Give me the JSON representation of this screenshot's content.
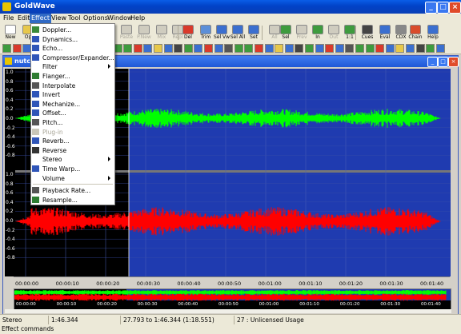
{
  "app": {
    "title": "GoldWave"
  },
  "window_controls": {
    "minimize": "_",
    "maximize": "□",
    "close": "×"
  },
  "menubar": [
    "File",
    "Edit",
    "Effect",
    "View",
    "Tool",
    "Options",
    "Window",
    "Help"
  ],
  "toolbar": {
    "buttons": [
      {
        "label": "New",
        "icon": "new-file-icon",
        "color": "#ffffff",
        "enabled": true
      },
      {
        "label": "Op",
        "icon": "open-icon",
        "color": "#e7c84a",
        "enabled": true
      },
      {
        "label": "Paste",
        "icon": "paste-icon",
        "color": "#cfccbf",
        "enabled": false
      },
      {
        "label": "P.New",
        "icon": "paste-new-icon",
        "color": "#cfccbf",
        "enabled": false
      },
      {
        "label": "Mix",
        "icon": "mix-icon",
        "color": "#cfccbf",
        "enabled": false
      },
      {
        "label": "Repl",
        "icon": "replace-icon",
        "color": "#cfccbf",
        "enabled": false
      },
      {
        "label": "Del",
        "icon": "delete-icon",
        "color": "#d93a2b",
        "enabled": true
      },
      {
        "label": "Trim",
        "icon": "trim-icon",
        "color": "#5b8fd8",
        "enabled": true
      },
      {
        "label": "Sel Vw",
        "icon": "select-view-icon",
        "color": "#3b6fcf",
        "enabled": true
      },
      {
        "label": "Sel All",
        "icon": "select-all-icon",
        "color": "#3b6fcf",
        "enabled": true
      },
      {
        "label": "Set",
        "icon": "set-icon",
        "color": "#3b6fcf",
        "enabled": true
      },
      {
        "label": "All",
        "icon": "zoom-all-icon",
        "color": "#cfccbf",
        "enabled": false
      },
      {
        "label": "Sel",
        "icon": "zoom-sel-icon",
        "color": "#3e9b3e",
        "enabled": true
      },
      {
        "label": "Prev",
        "icon": "zoom-prev-icon",
        "color": "#cfccbf",
        "enabled": false
      },
      {
        "label": "In",
        "icon": "zoom-in-icon",
        "color": "#3e9b3e",
        "enabled": true
      },
      {
        "label": "Out",
        "icon": "zoom-out-icon",
        "color": "#cfccbf",
        "enabled": false
      },
      {
        "label": "1:1",
        "icon": "zoom-1to1-icon",
        "color": "#3e9b3e",
        "enabled": true
      },
      {
        "label": "Cues",
        "icon": "cues-icon",
        "color": "#444444",
        "enabled": true
      },
      {
        "label": "Eval",
        "icon": "eval-icon",
        "color": "#3b6fcf",
        "enabled": true
      },
      {
        "label": "CDX",
        "icon": "cdx-icon",
        "color": "#888888",
        "enabled": true
      },
      {
        "label": "Chain",
        "icon": "chain-icon",
        "color": "#d94b2b",
        "enabled": true
      },
      {
        "label": "Help",
        "icon": "help-icon",
        "color": "#3b6fcf",
        "enabled": true
      }
    ]
  },
  "effect_menu": {
    "items": [
      {
        "label": "Doppler...",
        "icon": "doppler-icon",
        "color": "#3a8a3a",
        "submenu": false,
        "enabled": true
      },
      {
        "label": "Dynamics...",
        "icon": "dynamics-icon",
        "color": "#2f55b8",
        "submenu": false,
        "enabled": true
      },
      {
        "label": "Echo...",
        "icon": "echo-icon",
        "color": "#2f55b8",
        "submenu": false,
        "enabled": true
      },
      {
        "label": "Compressor/Expander...",
        "icon": "compressor-icon",
        "color": "#2f55b8",
        "submenu": false,
        "enabled": true
      },
      {
        "label": "Filter",
        "icon": "",
        "color": "",
        "submenu": true,
        "enabled": true
      },
      {
        "label": "Flanger...",
        "icon": "flanger-icon",
        "color": "#2e7d32",
        "submenu": false,
        "enabled": true
      },
      {
        "label": "Interpolate",
        "icon": "interpolate-icon",
        "color": "#555555",
        "submenu": false,
        "enabled": true
      },
      {
        "label": "Invert",
        "icon": "invert-icon",
        "color": "#2f55b8",
        "submenu": false,
        "enabled": true
      },
      {
        "label": "Mechanize...",
        "icon": "mechanize-icon",
        "color": "#2f55b8",
        "submenu": false,
        "enabled": true
      },
      {
        "label": "Offset...",
        "icon": "offset-icon",
        "color": "#2f55b8",
        "submenu": false,
        "enabled": true
      },
      {
        "label": "Pitch...",
        "icon": "pitch-icon",
        "color": "#555555",
        "submenu": false,
        "enabled": true
      },
      {
        "label": "Plug-in",
        "icon": "plugin-icon",
        "color": "#c9c6b8",
        "submenu": false,
        "enabled": false
      },
      {
        "label": "Reverb...",
        "icon": "reverb-icon",
        "color": "#2f55b8",
        "submenu": false,
        "enabled": true
      },
      {
        "label": "Reverse",
        "icon": "reverse-icon",
        "color": "#333333",
        "submenu": false,
        "enabled": true
      },
      {
        "label": "Stereo",
        "icon": "",
        "color": "",
        "submenu": true,
        "enabled": true
      },
      {
        "label": "Time Warp...",
        "icon": "time-warp-icon",
        "color": "#2f55b8",
        "submenu": false,
        "enabled": true
      },
      {
        "label": "Volume",
        "icon": "",
        "color": "",
        "submenu": true,
        "enabled": true
      },
      {
        "label": "Playback Rate...",
        "icon": "playback-rate-icon",
        "color": "#555555",
        "submenu": false,
        "enabled": true
      },
      {
        "label": "Resample...",
        "icon": "resample-icon",
        "color": "#2e7d32",
        "submenu": false,
        "enabled": true
      }
    ]
  },
  "document": {
    "title": "nutc",
    "y_labels": [
      "1.0",
      "0.8",
      "0.6",
      "0.4",
      "0.2",
      "0.0",
      "-0.2",
      "-0.4",
      "-0.6",
      "-0.8",
      "1.0",
      "0.8",
      "0.6",
      "0.4",
      "0.2",
      "0.0",
      "-0.2",
      "-0.4",
      "-0.6",
      "-0.8"
    ],
    "time_labels": [
      "00:00:00",
      "00:00:10",
      "00:00:20",
      "00:00:30",
      "00:00:40",
      "00:00:50",
      "00:01:00",
      "00:01:10",
      "00:01:20",
      "00:01:30",
      "00:01:40"
    ],
    "overview_labels": [
      "00:00:00",
      "00:00:10",
      "00:00:20",
      "00:00:30",
      "00:00:40",
      "00:00:50",
      "00:01:00",
      "00:01:10",
      "00:01:20",
      "00:01:30",
      "00:01:40"
    ],
    "colors": {
      "left_channel": "#00ff00",
      "right_channel": "#ff0000",
      "background": "#1f3bb0",
      "unselected": "#000000"
    }
  },
  "status": {
    "channels": "Stereo",
    "length": "1:46.344",
    "selection": "27.793 to 1:46.344 (1:18.551)",
    "usage": "27 : Unlicensed Usage",
    "hint": "Effect commands"
  }
}
